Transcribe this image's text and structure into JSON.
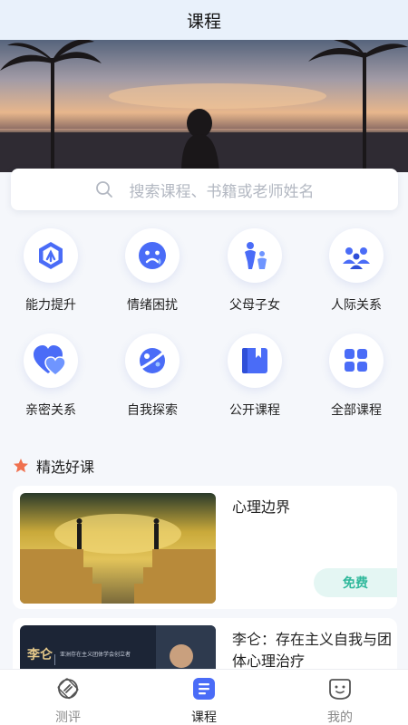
{
  "header": {
    "title": "课程"
  },
  "search": {
    "placeholder": "搜索课程、书籍或老师姓名"
  },
  "categories": [
    {
      "label": "能力提升",
      "icon": "ability-hexagon-icon"
    },
    {
      "label": "情绪困扰",
      "icon": "emotion-face-icon"
    },
    {
      "label": "父母子女",
      "icon": "parent-child-icon"
    },
    {
      "label": "人际关系",
      "icon": "people-group-icon"
    },
    {
      "label": "亲密关系",
      "icon": "heart-icon"
    },
    {
      "label": "自我探索",
      "icon": "planet-icon"
    },
    {
      "label": "公开课程",
      "icon": "book-icon"
    },
    {
      "label": "全部课程",
      "icon": "grid-icon"
    }
  ],
  "section": {
    "title": "精选好课"
  },
  "courses": [
    {
      "title": "心理边界",
      "badge": "免费"
    },
    {
      "title": "李仑：存在主义自我与团体心理治疗",
      "thumb_name": "李仑",
      "thumb_subtitle": "亚洲存在主义团体学会创立者"
    }
  ],
  "tabbar": [
    {
      "label": "测评",
      "active": false
    },
    {
      "label": "课程",
      "active": true
    },
    {
      "label": "我的",
      "active": false
    }
  ],
  "colors": {
    "accent": "#4a6cf7",
    "free_badge": "#2fb89b",
    "star": "#f0714f"
  }
}
